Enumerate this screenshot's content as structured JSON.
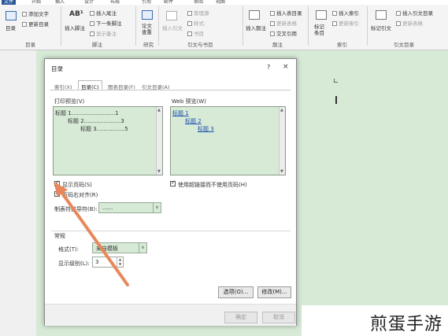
{
  "ribbon": {
    "tabs": [
      "文件",
      "开始",
      "插入",
      "设计",
      "布局",
      "引用",
      "邮件",
      "审阅",
      "视图"
    ],
    "toc_group": {
      "toc_button": "目录",
      "add_text": "添加文字",
      "update_toc": "更新目录",
      "label": "目录"
    },
    "footnote_group": {
      "insert_footnote": "插入脚注",
      "insert_endnote": "插入尾注",
      "next_footnote": "下一条脚注",
      "show_notes": "显示备注",
      "ab_icon": "AB¹",
      "label": "脚注"
    },
    "research_group": {
      "search": "论文查重",
      "label": "研究"
    },
    "citation_group": {
      "insert_citation": "插入引文",
      "manage_sources": "管理源",
      "style": "样式:",
      "bibliography": "书目",
      "label": "引文与书目"
    },
    "caption_group": {
      "insert_caption": "插入题注",
      "insert_table_of_figures": "插入表目录",
      "update_table": "更新表格",
      "cross_reference": "交叉引用",
      "label": "题注"
    },
    "index_group": {
      "mark_entry": "标记条目",
      "insert_index": "插入索引",
      "update_index": "更新索引",
      "label": "索引"
    },
    "authorities_group": {
      "mark_citation": "标记引文",
      "insert_toa": "插入引文目录",
      "update_table": "更新表格",
      "label": "引文目录"
    }
  },
  "dialog": {
    "title": "目录",
    "help": "?",
    "close": "×",
    "tabs": [
      "索引(X)",
      "目录(C)",
      "图表目录(F)",
      "引文目录(A)"
    ],
    "active_tab": 1,
    "print_preview": {
      "label": "打印预览(V)",
      "lines": [
        {
          "text": "标题 1.........................1"
        },
        {
          "text": "标题 2.....................3"
        },
        {
          "text": "标题 3................5"
        }
      ]
    },
    "web_preview": {
      "label": "Web 预览(W)",
      "links": [
        "标题 1",
        "标题 2",
        "标题 3"
      ]
    },
    "show_page_numbers": "显示页码(S)",
    "right_align": "页码右对齐(R)",
    "tab_leader_label": "制表符前导符(B):",
    "tab_leader_value": "......",
    "use_hyperlinks": "使用超链接而不使用页码(H)",
    "general_label": "常规",
    "formats_label": "格式(T):",
    "formats_value": "来自模板",
    "levels_label": "显示级别(L):",
    "levels_value": "3",
    "options_button": "选项(O)...",
    "modify_button": "修改(M)...",
    "ok_button": "确定",
    "cancel_button": "取消"
  },
  "watermark": "煎蛋手游",
  "colors": {
    "preview_bg": "#d6ead6",
    "link": "#2050b0",
    "arrow": "#e8875a",
    "ribbon_tab": "#2b579a"
  }
}
